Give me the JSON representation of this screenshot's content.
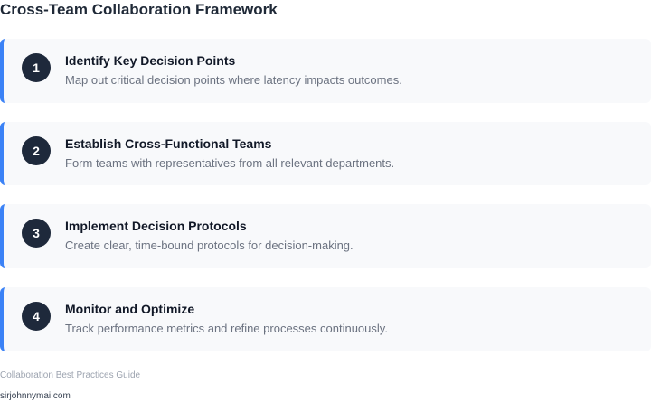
{
  "header": {
    "title": "Cross-Team Collaboration Framework"
  },
  "steps": [
    {
      "number": "1",
      "title": "Identify Key Decision Points",
      "description": "Map out critical decision points where latency impacts outcomes."
    },
    {
      "number": "2",
      "title": "Establish Cross-Functional Teams",
      "description": "Form teams with representatives from all relevant departments."
    },
    {
      "number": "3",
      "title": "Implement Decision Protocols",
      "description": "Create clear, time-bound protocols for decision-making."
    },
    {
      "number": "4",
      "title": "Monitor and Optimize",
      "description": "Track performance metrics and refine processes continuously."
    }
  ],
  "footer": {
    "caption": "Collaboration Best Practices Guide",
    "link": "sirjohnnymai.com"
  },
  "colors": {
    "accent": "#3b82f6",
    "badge": "#1e293b",
    "card_background": "#f8f9fb"
  }
}
